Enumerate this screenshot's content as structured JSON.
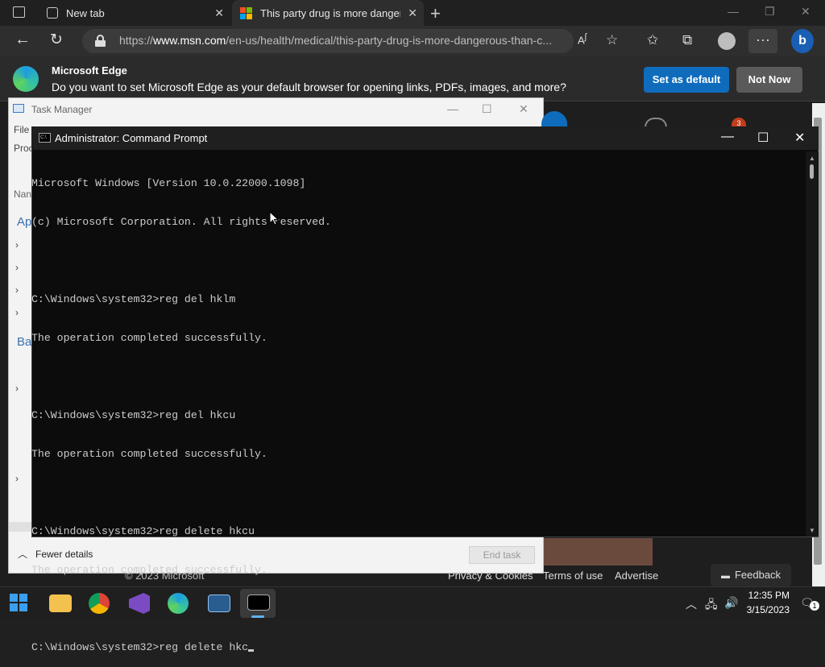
{
  "browser": {
    "tabs": [
      {
        "label": "New tab",
        "icon": "newtab-icon"
      },
      {
        "label": "This party drug is more dangero",
        "icon": "microsoft-logo-icon",
        "active": true
      }
    ],
    "url_prefix": "https://",
    "url_domain": "www.msn.com",
    "url_path": "/en-us/health/medical/this-party-drug-is-more-dangerous-than-c...",
    "banner": {
      "title": "Microsoft Edge",
      "text": "Do you want to set Microsoft Edge as your default browser for opening links, PDFs, images, and more?",
      "primary_button": "Set as default",
      "secondary_button": "Not Now"
    },
    "footer": {
      "copyright": "© 2023 Microsoft",
      "privacy": "Privacy & Cookies",
      "terms": "Terms of use",
      "advertise": "Advertise",
      "feedback": "Feedback"
    },
    "notification_count": "3"
  },
  "taskmanager": {
    "title": "Task Manager",
    "menu_file": "File",
    "tab_partial": "Proc",
    "col_partial": "Nan",
    "group_apps": "Ap",
    "group_background": "Ba",
    "fewer_details": "Fewer details",
    "end_task": "End task"
  },
  "cmd": {
    "title": "Administrator: Command Prompt",
    "icon_text": "C:\\",
    "lines": [
      "Microsoft Windows [Version 10.0.22000.1098]",
      "(c) Microsoft Corporation. All rights reserved.",
      "",
      "C:\\Windows\\system32>reg del hklm",
      "The operation completed successfully.",
      "",
      "C:\\Windows\\system32>reg del hkcu",
      "The operation completed successfully.",
      "",
      "C:\\Windows\\system32>reg delete hkcu",
      "The operation completed successfully.",
      "",
      "C:\\Windows\\system32>reg delete hkc"
    ]
  },
  "taskbar": {
    "apps": [
      "start-icon",
      "file-explorer-icon",
      "chrome-icon",
      "visual-studio-icon",
      "edge-icon",
      "performance-monitor-icon",
      "command-prompt-icon"
    ],
    "time": "12:35 PM",
    "date": "3/15/2023",
    "notification_badge": "1"
  },
  "colors": {
    "accent_blue": "#0f6cbd",
    "cmd_background": "#0c0c0c",
    "cmd_text": "#cccccc"
  }
}
